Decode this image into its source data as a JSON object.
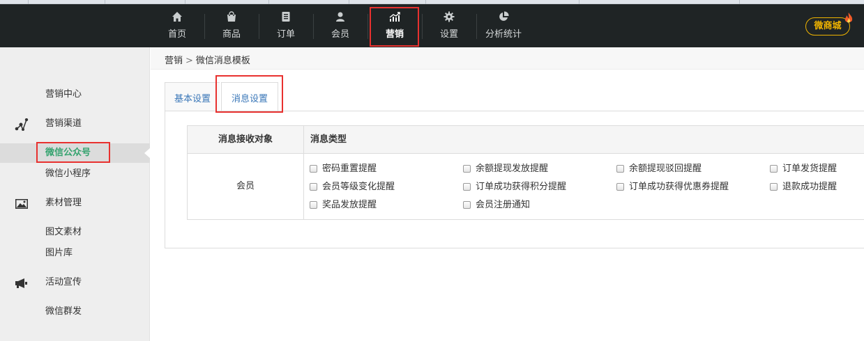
{
  "nav": {
    "items": [
      {
        "label": "首页",
        "icon": "home-icon"
      },
      {
        "label": "商品",
        "icon": "bag-icon"
      },
      {
        "label": "订单",
        "icon": "order-icon"
      },
      {
        "label": "会员",
        "icon": "user-icon"
      },
      {
        "label": "营销",
        "icon": "chart-up-icon",
        "active": true
      },
      {
        "label": "设置",
        "icon": "gear-icon"
      },
      {
        "label": "分析统计",
        "icon": "pie-icon"
      }
    ],
    "shop_badge": "微商城"
  },
  "sidebar": {
    "items": [
      {
        "label": "营销中心"
      },
      {
        "label": "营销渠道",
        "icon": "nodes-icon"
      },
      {
        "label": "微信公众号",
        "active": true
      },
      {
        "label": "微信小程序"
      },
      {
        "label": "素材管理",
        "icon": "image-icon"
      },
      {
        "label": "图文素材"
      },
      {
        "label": "图片库"
      },
      {
        "label": "活动宣传",
        "icon": "megaphone-icon"
      },
      {
        "label": "微信群发"
      }
    ]
  },
  "breadcrumb": {
    "parent": "营销",
    "separator": ">",
    "current": "微信消息模板"
  },
  "tabs": [
    {
      "label": "基本设置",
      "active": false
    },
    {
      "label": "消息设置",
      "active": true
    }
  ],
  "table": {
    "headers": [
      "消息接收对象",
      "消息类型"
    ],
    "target": "会员",
    "message_types": [
      [
        "密码重置提醒",
        "余额提现发放提醒",
        "余额提现驳回提醒",
        "订单发货提醒"
      ],
      [
        "会员等级变化提醒",
        "订单成功获得积分提醒",
        "订单成功获得优惠券提醒",
        "退款成功提醒"
      ],
      [
        "奖品发放提醒",
        "会员注册通知"
      ]
    ]
  },
  "colors": {
    "topbar": "#1f2425",
    "highlight": "#e8312f",
    "active_green": "#35a36f",
    "badge": "#f0b400",
    "link_blue": "#3a77b8"
  }
}
